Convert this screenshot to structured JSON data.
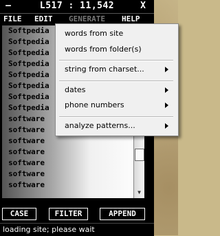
{
  "window": {
    "title": "L517 : 11,542",
    "minimize_label": "—",
    "close_label": "X"
  },
  "menubar": [
    {
      "label": "FILE"
    },
    {
      "label": "EDIT"
    },
    {
      "label": "GENERATE"
    },
    {
      "label": "HELP"
    }
  ],
  "list_items": [
    "Softpedia",
    "Softpedia",
    "Softpedia",
    "Softpedia",
    "Softpedia",
    "Softpedia",
    "Softpedia",
    "Softpedia",
    "software",
    "software",
    "software",
    "software",
    "software",
    "software",
    "software"
  ],
  "buttons": {
    "case": "CASE",
    "filter": "FILTER",
    "append": "APPEND"
  },
  "status": "loading site; please wait",
  "generate_menu": {
    "items": [
      {
        "label": "words from site",
        "submenu": false
      },
      {
        "label": "words from folder(s)",
        "submenu": false
      },
      {
        "label": "string from charset...",
        "submenu": true
      },
      {
        "label": "dates",
        "submenu": true
      },
      {
        "label": "phone numbers",
        "submenu": true
      },
      {
        "label": "analyze patterns...",
        "submenu": true
      }
    ]
  }
}
